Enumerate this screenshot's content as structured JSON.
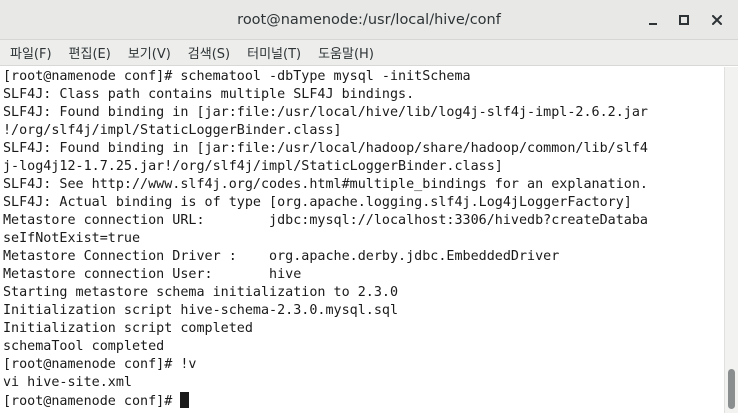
{
  "window": {
    "title": "root@namenode:/usr/local/hive/conf",
    "minimize_icon": "minimize-icon",
    "maximize_icon": "maximize-icon",
    "close_icon": "close-icon"
  },
  "menu": {
    "items": [
      {
        "label": "파일(F)"
      },
      {
        "label": "편집(E)"
      },
      {
        "label": "보기(V)"
      },
      {
        "label": "검색(S)"
      },
      {
        "label": "터미널(T)"
      },
      {
        "label": "도움말(H)"
      }
    ]
  },
  "terminal": {
    "lines": [
      "[root@namenode conf]# schematool -dbType mysql -initSchema",
      "SLF4J: Class path contains multiple SLF4J bindings.",
      "SLF4J: Found binding in [jar:file:/usr/local/hive/lib/log4j-slf4j-impl-2.6.2.jar",
      "!/org/slf4j/impl/StaticLoggerBinder.class]",
      "SLF4J: Found binding in [jar:file:/usr/local/hadoop/share/hadoop/common/lib/slf4",
      "j-log4j12-1.7.25.jar!/org/slf4j/impl/StaticLoggerBinder.class]",
      "SLF4J: See http://www.slf4j.org/codes.html#multiple_bindings for an explanation.",
      "SLF4J: Actual binding is of type [org.apache.logging.slf4j.Log4jLoggerFactory]",
      "Metastore connection URL:        jdbc:mysql://localhost:3306/hivedb?createDataba",
      "seIfNotExist=true",
      "Metastore Connection Driver :    org.apache.derby.jdbc.EmbeddedDriver",
      "Metastore connection User:       hive",
      "Starting metastore schema initialization to 2.3.0",
      "Initialization script hive-schema-2.3.0.mysql.sql",
      "Initialization script completed",
      "schemaTool completed",
      "[root@namenode conf]# !v",
      "vi hive-site.xml"
    ],
    "prompt": "[root@namenode conf]# "
  }
}
